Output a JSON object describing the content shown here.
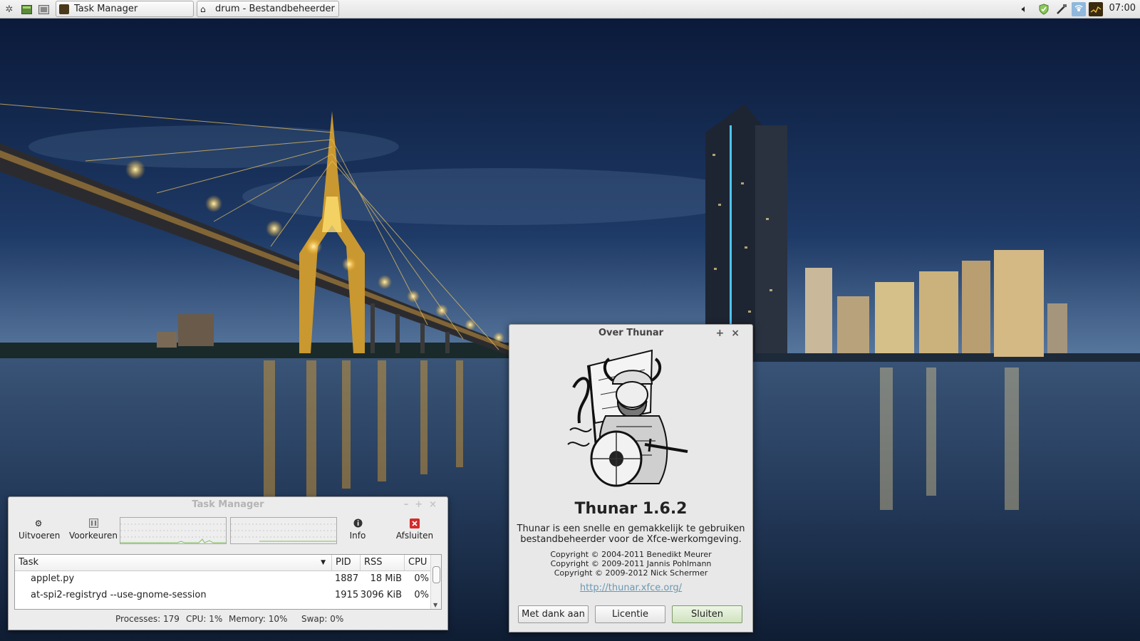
{
  "panel": {
    "taskbar": [
      {
        "label": "Task Manager",
        "active": true
      },
      {
        "label": "drum - Bestandbeheerder",
        "active": false
      }
    ],
    "clock": "07:00"
  },
  "task_manager": {
    "title": "Task Manager",
    "toolbar": {
      "run_label": "Uitvoeren",
      "preferences_label": "Voorkeuren",
      "info_label": "Info",
      "quit_label": "Afsluiten"
    },
    "columns": {
      "task": "Task",
      "pid": "PID",
      "rss": "RSS",
      "cpu": "CPU"
    },
    "rows": [
      {
        "task": "applet.py",
        "pid": "1887",
        "rss": "18 MiB",
        "cpu": "0%"
      },
      {
        "task": "at-spi2-registryd --use-gnome-session",
        "pid": "1915",
        "rss": "3096 KiB",
        "cpu": "0%"
      }
    ],
    "status": {
      "processes": "Processes: 179",
      "cpu": "CPU: 1%",
      "memory": "Memory: 10%",
      "swap": "Swap: 0%"
    }
  },
  "about_dialog": {
    "title": "Over Thunar",
    "app_name": "Thunar 1.6.2",
    "description_line1": "Thunar is een snelle en gemakkelijk te gebruiken",
    "description_line2": "bestandbeheerder voor de Xfce-werkomgeving.",
    "copyright": [
      "Copyright © 2004-2011 Benedikt Meurer",
      "Copyright © 2009-2011 Jannis Pohlmann",
      "Copyright © 2009-2012 Nick Schermer"
    ],
    "url": "http://thunar.xfce.org/",
    "buttons": {
      "credits": "Met dank aan",
      "license": "Licentie",
      "close": "Sluiten"
    }
  },
  "colors": {
    "panel_bg": "#e8e8e8",
    "link": "#6a98b4",
    "default_button": "#cfe2bf",
    "quit_icon": "#d42a2a",
    "graph_line": "#7fbf5f"
  }
}
